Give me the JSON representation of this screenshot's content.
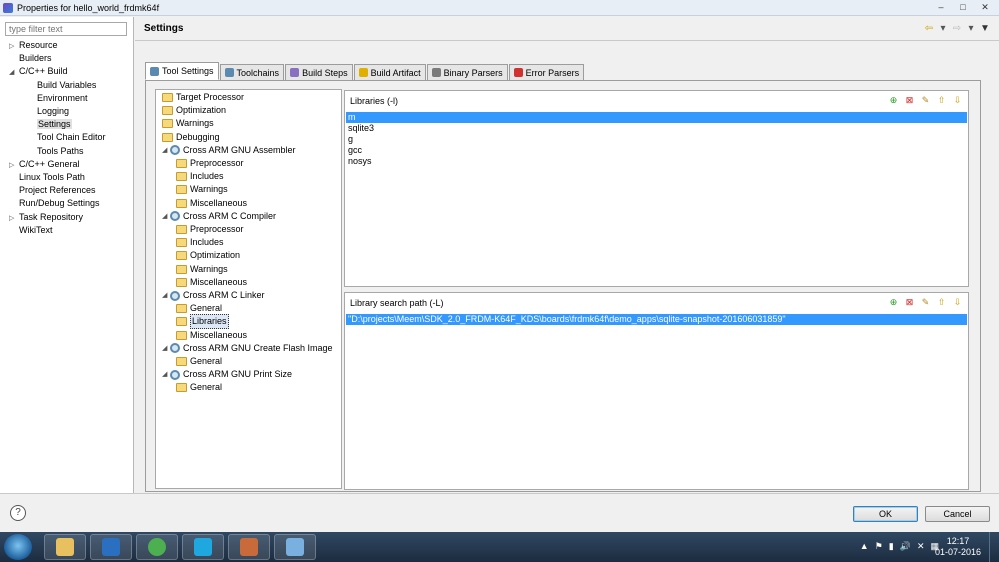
{
  "window": {
    "title": "Properties for hello_world_frdmk64f",
    "controls": [
      "–",
      "□",
      "✕"
    ]
  },
  "left_panel": {
    "filter_placeholder": "type filter text",
    "items": [
      {
        "label": "Resource",
        "arrow": "▷"
      },
      {
        "label": "Builders",
        "arrow": ""
      },
      {
        "label": "C/C++ Build",
        "arrow": "◢"
      },
      {
        "label": "Build Variables",
        "arrow": ""
      },
      {
        "label": "Environment",
        "arrow": ""
      },
      {
        "label": "Logging",
        "arrow": ""
      },
      {
        "label": "Settings",
        "arrow": ""
      },
      {
        "label": "Tool Chain Editor",
        "arrow": ""
      },
      {
        "label": "Tools Paths",
        "arrow": ""
      },
      {
        "label": "C/C++ General",
        "arrow": "▷"
      },
      {
        "label": "Linux Tools Path",
        "arrow": ""
      },
      {
        "label": "Project References",
        "arrow": ""
      },
      {
        "label": "Run/Debug Settings",
        "arrow": ""
      },
      {
        "label": "Task Repository",
        "arrow": "▷"
      },
      {
        "label": "WikiText",
        "arrow": ""
      }
    ]
  },
  "header": {
    "title": "Settings",
    "nav": [
      "⇦",
      "▾",
      "⇨",
      "▾",
      "▼"
    ]
  },
  "tabs": [
    {
      "label": "Tool Settings",
      "color": "#5a8ab0"
    },
    {
      "label": "Toolchains",
      "color": "#5a8ab0"
    },
    {
      "label": "Build Steps",
      "color": "#8a6fc0"
    },
    {
      "label": "Build Artifact",
      "color": "#e0b000"
    },
    {
      "label": "Binary Parsers",
      "color": "#7a7a7a"
    },
    {
      "label": "Error Parsers",
      "color": "#d03030"
    }
  ],
  "tool_tree": [
    {
      "label": "Target Processor",
      "icon": "folder"
    },
    {
      "label": "Optimization",
      "icon": "folder"
    },
    {
      "label": "Warnings",
      "icon": "folder"
    },
    {
      "label": "Debugging",
      "icon": "folder"
    },
    {
      "label": "Cross ARM GNU Assembler",
      "icon": "gear"
    },
    {
      "label": "Preprocessor",
      "icon": "folder"
    },
    {
      "label": "Includes",
      "icon": "folder"
    },
    {
      "label": "Warnings",
      "icon": "folder"
    },
    {
      "label": "Miscellaneous",
      "icon": "folder"
    },
    {
      "label": "Cross ARM C Compiler",
      "icon": "gear"
    },
    {
      "label": "Preprocessor",
      "icon": "folder"
    },
    {
      "label": "Includes",
      "icon": "folder"
    },
    {
      "label": "Optimization",
      "icon": "folder"
    },
    {
      "label": "Warnings",
      "icon": "folder"
    },
    {
      "label": "Miscellaneous",
      "icon": "folder"
    },
    {
      "label": "Cross ARM C Linker",
      "icon": "gear"
    },
    {
      "label": "General",
      "icon": "folder"
    },
    {
      "label": "Libraries",
      "icon": "folder"
    },
    {
      "label": "Miscellaneous",
      "icon": "folder"
    },
    {
      "label": "Cross ARM GNU Create Flash Image",
      "icon": "gear"
    },
    {
      "label": "General",
      "icon": "folder"
    },
    {
      "label": "Cross ARM GNU Print Size",
      "icon": "gear"
    },
    {
      "label": "General",
      "icon": "folder"
    }
  ],
  "libraries_pane": {
    "title": "Libraries (-l)",
    "items": [
      "m",
      "sqlite3",
      "g",
      "gcc",
      "nosys"
    ],
    "toolbar": [
      "add-icon",
      "delete-icon",
      "edit-icon",
      "move-up-icon",
      "move-down-icon"
    ]
  },
  "path_pane": {
    "title": "Library search path (-L)",
    "items": [
      "\"D:\\projects\\Meem\\SDK_2.0_FRDM-K64F_KDS\\boards\\frdmk64f\\demo_apps\\sqlite-snapshot-201606031859\""
    ],
    "toolbar": [
      "add-icon",
      "delete-icon",
      "edit-icon",
      "move-up-icon",
      "move-down-icon"
    ]
  },
  "buttons": {
    "ok": "OK",
    "cancel": "Cancel",
    "help": "?"
  },
  "taskbar": {
    "apps": [
      "file-explorer",
      "outlook",
      "chrome",
      "skype",
      "pinned-app",
      "paint"
    ],
    "tray": [
      "▲",
      "⚑",
      "▮",
      "🔊",
      "✕",
      "▦"
    ],
    "time": "12:17",
    "date": "01-07-2016"
  }
}
